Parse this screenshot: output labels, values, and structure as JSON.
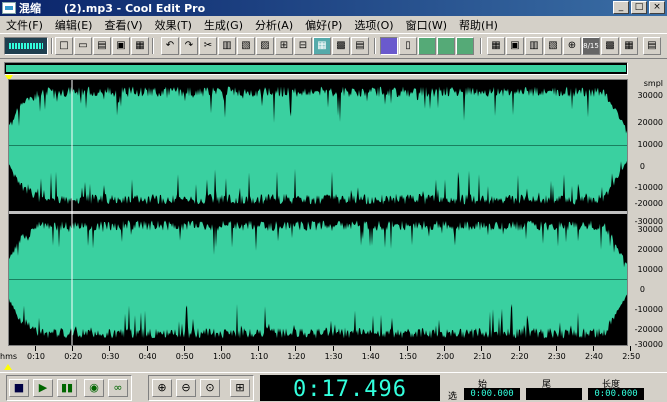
{
  "window": {
    "title": "混缩      (2).mp3 - Cool Edit Pro",
    "controls": [
      "_",
      "□",
      "×"
    ]
  },
  "menu": [
    "文件(F)",
    "编辑(E)",
    "查看(V)",
    "效果(T)",
    "生成(G)",
    "分析(A)",
    "偏好(P)",
    "选项(O)",
    "窗口(W)",
    "帮助(H)"
  ],
  "toolbar": {
    "icons": [
      "new-file-icon",
      "open-file-icon",
      "append-icon",
      "save-icon",
      "save-selection-icon",
      "undo-icon",
      "redo-icon",
      "cut-icon",
      "copy-icon",
      "paste-icon",
      "mix-paste-icon",
      "crop-icon",
      "trim-icon",
      "cd-icon",
      "envelope-icon",
      "show-spectral-icon",
      "show-waveform-icon",
      "show-frequency-icon",
      "cue-list-icon",
      "play-list-icon",
      "info-icon",
      "zoom-icon",
      "sample-rate-icon",
      "level-meter-icon",
      "settings-icon"
    ],
    "sample_rate_label": "8/15"
  },
  "scale": {
    "unit": "smpl",
    "upper": [
      "smpl",
      "30000",
      "20000",
      "10000",
      "0",
      "-10000",
      "-20000",
      "-30000"
    ],
    "lower": [
      "30000",
      "20000",
      "10000",
      "0",
      "-10000",
      "-20000",
      "-30000"
    ]
  },
  "ruler": {
    "unit": "hms",
    "ticks": [
      "0:10",
      "0:20",
      "0:30",
      "0:40",
      "0:50",
      "1:00",
      "1:10",
      "1:20",
      "1:30",
      "1:40",
      "1:50",
      "2:00",
      "2:10",
      "2:20",
      "2:30",
      "2:40",
      "2:50"
    ]
  },
  "transport": {
    "buttons": [
      "stop-icon",
      "play-icon",
      "pause-icon",
      "play-to-end-icon",
      "loop-icon"
    ],
    "zoom_buttons": [
      "zoom-in-icon",
      "zoom-out-icon",
      "zoom-full-icon",
      "zoom-selection-icon"
    ],
    "time": "0:17.496"
  },
  "selection": {
    "row_label": "选",
    "headers": [
      "始",
      "尾",
      "长度"
    ],
    "values": [
      "0:00.000",
      "",
      "0:00.000"
    ]
  },
  "colors": {
    "wave": "#3ad0a0",
    "background": "#000000",
    "time_text": "#33ffdd",
    "marker": "#ffff00"
  }
}
